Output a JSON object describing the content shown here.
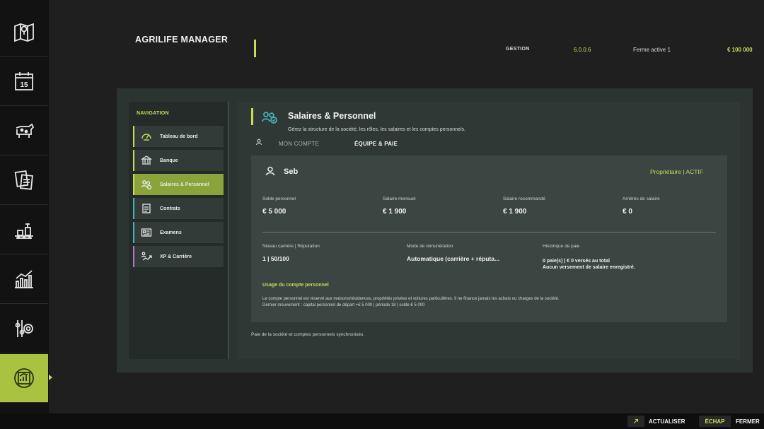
{
  "header": {
    "title": "AGRILIFE MANAGER",
    "mode": "GESTION",
    "version": "6.0.0.6",
    "farm": "Ferme active 1",
    "money": "€ 100 000"
  },
  "rail": {
    "items": [
      {
        "icon": "map-icon"
      },
      {
        "icon": "calendar-icon",
        "text": "15"
      },
      {
        "icon": "cow-icon"
      },
      {
        "icon": "documents-icon"
      },
      {
        "icon": "production-icon"
      },
      {
        "icon": "statistics-icon"
      },
      {
        "icon": "settings-icon"
      },
      {
        "icon": "agrilife-manager-icon",
        "active": true
      }
    ]
  },
  "navigation": {
    "heading": "NAVIGATION",
    "items": [
      {
        "label": "Tableau de bord",
        "icon": "gauge-icon"
      },
      {
        "label": "Banque",
        "icon": "bank-icon"
      },
      {
        "label": "Salaires & Personnel",
        "icon": "people-icon",
        "active": true
      },
      {
        "label": "Contrats",
        "icon": "contract-icon"
      },
      {
        "label": "Examens",
        "icon": "exam-icon"
      },
      {
        "label": "XP & Carrière",
        "icon": "career-icon"
      }
    ]
  },
  "content": {
    "title": "Salaires & Personnel",
    "subtitle": "Gérez la structure de la société, les rôles, les salaires et les comptes personnels.",
    "tabs": [
      {
        "label": "MON COMPTE"
      },
      {
        "label": "ÉQUIPE & PAIE",
        "active": true
      }
    ],
    "card": {
      "name": "Seb",
      "role": "Propriétaire  |  ACTIF",
      "stats": [
        {
          "label": "Solde personnel",
          "value": "€ 5 000"
        },
        {
          "label": "Salaire mensuel",
          "value": "€ 1 900"
        },
        {
          "label": "Salaire recommandé",
          "value": "€ 1 900"
        },
        {
          "label": "Arriérés de salaire",
          "value": "€ 0"
        }
      ],
      "career_label": "Niveau carrière | Réputation",
      "career_value": "1  |  50/100",
      "pay_mode_label": "Mode de rémunération",
      "pay_mode_value": "Automatique (carrière + réputa...",
      "history_label": "Historique de paie",
      "history_line1": "0 paie(s) | € 0 versés au total",
      "history_line2": "Aucun versement de salaire enregistré.",
      "usage_title": "Usage du compte personnel",
      "usage_line1": "Le compte personnel est réservé aux maisons/résidences, propriétés privées et voitures particulières. Il ne finance jamais les achats ou charges de la société.",
      "usage_line2": "Dernier mouvement : capital personnel de départ +€ 5 000 | période 18 | solde € 5 000"
    },
    "footer_note": "Paie de la société et comptes personnels synchronisés."
  },
  "bottom_bar": {
    "refresh_label": "ACTUALISER",
    "close_key": "ÉCHAP",
    "close_label": "FERMER"
  },
  "colors": {
    "accent": "#c8dc5a",
    "active_nav": "#8aa33a",
    "teal": "#43b3b8",
    "purple": "#b07ac4"
  }
}
